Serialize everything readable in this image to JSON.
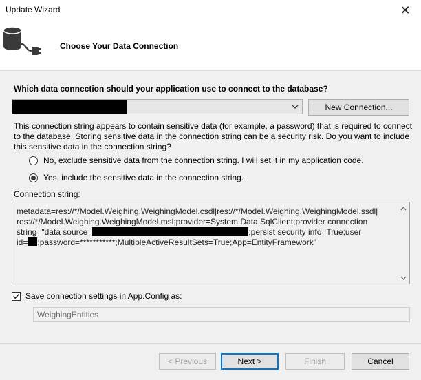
{
  "window": {
    "title": "Update Wizard",
    "close_glyph": "✕"
  },
  "header": {
    "title": "Choose Your Data Connection",
    "icon": "database-connection-icon"
  },
  "connection": {
    "question": "Which data connection should your application use to connect to the database?",
    "selected_value_redacted": true,
    "new_connection_label": "New Connection..."
  },
  "sensitive": {
    "warning": "This connection string appears to contain sensitive data (for example, a password) that is required to connect to the database. Storing sensitive data in the connection string can be a security risk. Do you want to include this sensitive data in the connection string?",
    "option_exclude": "No, exclude sensitive data from the connection string. I will set it in my application code.",
    "option_include": "Yes, include the sensitive data in the connection string.",
    "selected": "include"
  },
  "connection_string": {
    "label": "Connection string:",
    "line1": "metadata=res://*/Model.Weighing.WeighingModel.csdl|res://*/Model.Weighing.WeighingModel.ssdl|",
    "line2": "res://*/Model.Weighing.WeighingModel.msl;provider=System.Data.SqlClient;provider connection",
    "line3a": "string=\"data source=",
    "line3b": ";persist security info=True;user",
    "line4a": "id=",
    "line4b": ";password=***********;MultipleActiveResultSets=True;App=EntityFramework\""
  },
  "save": {
    "checkbox_label": "Save connection settings in App.Config as:",
    "checked": true,
    "value": "WeighingEntities"
  },
  "footer": {
    "previous": "< Previous",
    "next": "Next >",
    "finish": "Finish",
    "cancel": "Cancel"
  },
  "colors": {
    "accent": "#0078d7",
    "dialog_bg": "#f0f0f0",
    "header_bg": "#ffffff"
  }
}
